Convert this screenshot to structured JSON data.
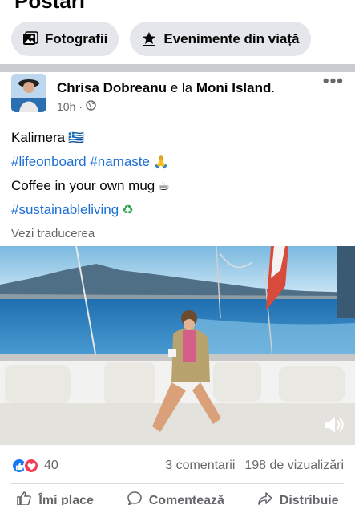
{
  "section": {
    "title": "Postări"
  },
  "chips": [
    {
      "label": "Fotografii",
      "icon": "photos-icon"
    },
    {
      "label": "Evenimente din viață",
      "icon": "life-event-icon"
    }
  ],
  "post": {
    "author": "Chrisa Dobreanu",
    "connector": " e la ",
    "place": "Moni Island",
    "suffix": ".",
    "time": "10h",
    "separator": "·",
    "privacy_icon": "globe-icon",
    "lines": [
      {
        "text": "Kalimera",
        "emoji": "🇬🇷",
        "kind": "plain"
      },
      {
        "text": "#lifeonboard #namaste",
        "emoji": "🙏",
        "kind": "tag"
      },
      {
        "text": "Coffee in your own mug",
        "emoji": "☕",
        "kind": "plain"
      },
      {
        "text": "#sustainableliving",
        "emoji": "♻",
        "kind": "tag"
      }
    ],
    "see_translation": "Vezi traducerea"
  },
  "stats": {
    "reactions_count": "40",
    "comments": "3 comentarii",
    "views": "198 de vizualizări"
  },
  "actions": {
    "like": "Îmi place",
    "comment": "Comentează",
    "share": "Distribuie"
  },
  "colors": {
    "link": "#1a6ed8",
    "like": "#1877f2",
    "love": "#f33e58",
    "muted": "#65676b"
  }
}
